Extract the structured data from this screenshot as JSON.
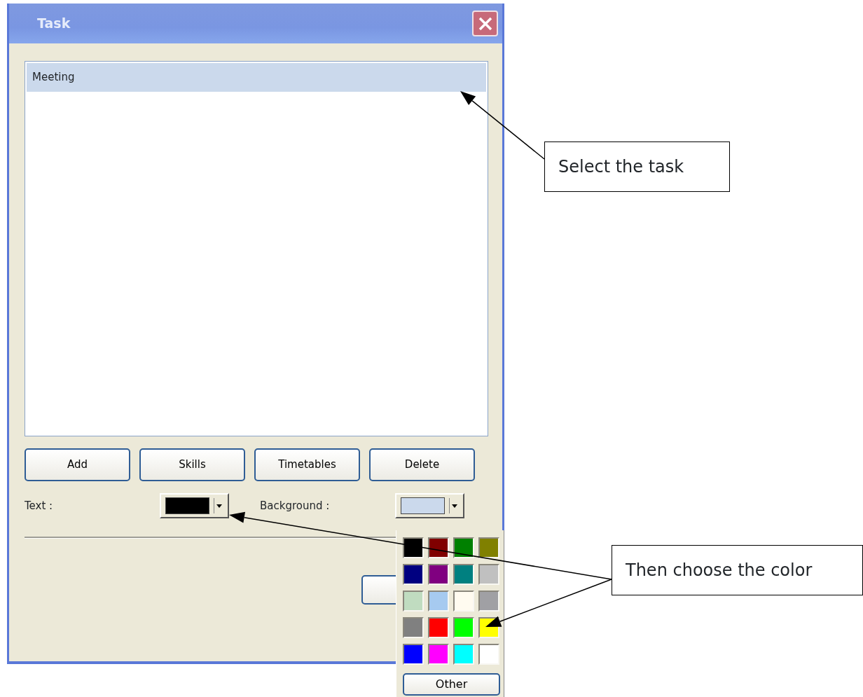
{
  "window": {
    "title": "Task"
  },
  "task_list": {
    "items": [
      {
        "label": "Meeting",
        "selected": true
      }
    ]
  },
  "buttons": [
    "Add",
    "Skills",
    "Timetables",
    "Delete"
  ],
  "text_color": {
    "label": "Text :",
    "color": "#000000"
  },
  "background_color": {
    "label": "Background :",
    "color": "#cbd9ec"
  },
  "color_popup": {
    "swatches": [
      {
        "color": "#000000"
      },
      {
        "color": "#800000"
      },
      {
        "color": "#008000"
      },
      {
        "color": "#808000"
      },
      {
        "color": "#000080"
      },
      {
        "color": "#800080"
      },
      {
        "color": "#008080"
      },
      {
        "color": "#c0c0c0"
      },
      {
        "color": "#c0dcc0"
      },
      {
        "color": "#a6caf0"
      },
      {
        "color": "#fffbf0"
      },
      {
        "color": "#a0a0a4"
      },
      {
        "color": "#808080"
      },
      {
        "color": "#ff0000"
      },
      {
        "color": "#00ff00"
      },
      {
        "color": "#ffff00"
      },
      {
        "color": "#0000ff"
      },
      {
        "color": "#ff00ff"
      },
      {
        "color": "#00ffff"
      },
      {
        "color": "#ffffff"
      }
    ],
    "other_button": "Other"
  },
  "callouts": [
    "Select the task",
    "Then choose the color"
  ]
}
